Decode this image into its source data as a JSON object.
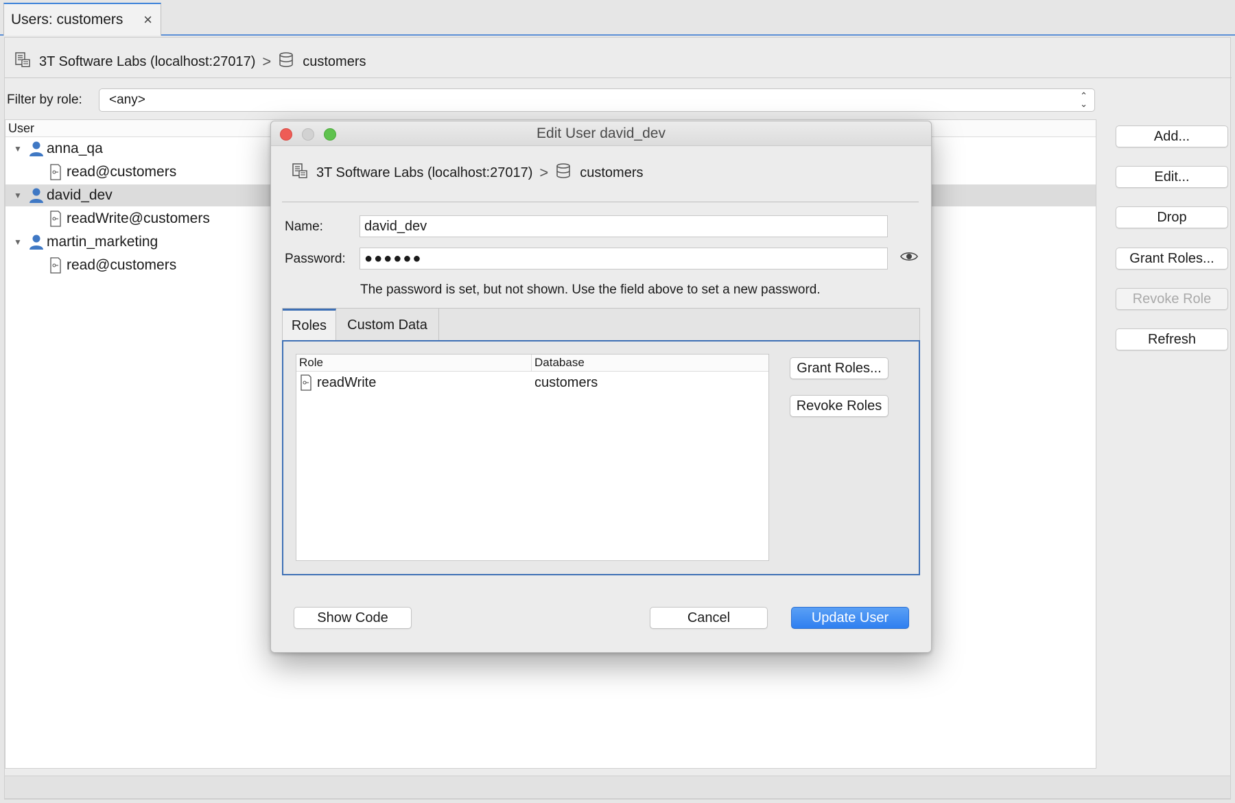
{
  "tab": {
    "title": "Users: customers",
    "close_icon": "×"
  },
  "breadcrumb": {
    "connection": "3T Software Labs (localhost:27017)",
    "separator": ">",
    "database": "customers"
  },
  "filter": {
    "label": "Filter by role:",
    "value": "<any>"
  },
  "tree": {
    "header": "User",
    "rows": [
      {
        "kind": "user",
        "label": "anna_qa",
        "expanded": true,
        "selected": false
      },
      {
        "kind": "role",
        "label": "read@customers"
      },
      {
        "kind": "user",
        "label": "david_dev",
        "expanded": true,
        "selected": true
      },
      {
        "kind": "role",
        "label": "readWrite@customers"
      },
      {
        "kind": "user",
        "label": "martin_marketing",
        "expanded": true,
        "selected": false
      },
      {
        "kind": "role",
        "label": "read@customers"
      }
    ]
  },
  "side_buttons": {
    "add": "Add...",
    "edit": "Edit...",
    "drop": "Drop",
    "grant": "Grant Roles...",
    "revoke": "Revoke Role",
    "refresh": "Refresh"
  },
  "dialog": {
    "title": "Edit User david_dev",
    "breadcrumb": {
      "connection": "3T Software Labs (localhost:27017)",
      "separator": ">",
      "database": "customers"
    },
    "name_label": "Name:",
    "name_value": "david_dev",
    "password_label": "Password:",
    "password_value": "●●●●●●",
    "hint": "The password is set, but not shown. Use the field above to set a new password.",
    "tabs": [
      "Roles",
      "Custom Data"
    ],
    "roles_table": {
      "headers": [
        "Role",
        "Database"
      ],
      "rows": [
        {
          "role": "readWrite",
          "database": "customers"
        }
      ]
    },
    "grant_button": "Grant Roles...",
    "revoke_button": "Revoke Roles",
    "show_code_button": "Show Code",
    "cancel_button": "Cancel",
    "update_button": "Update User"
  },
  "colors": {
    "accent": "#3d82d9",
    "primary_button": "#2f7ff0",
    "close": "#ee5c56",
    "zoom": "#5fc24e"
  }
}
